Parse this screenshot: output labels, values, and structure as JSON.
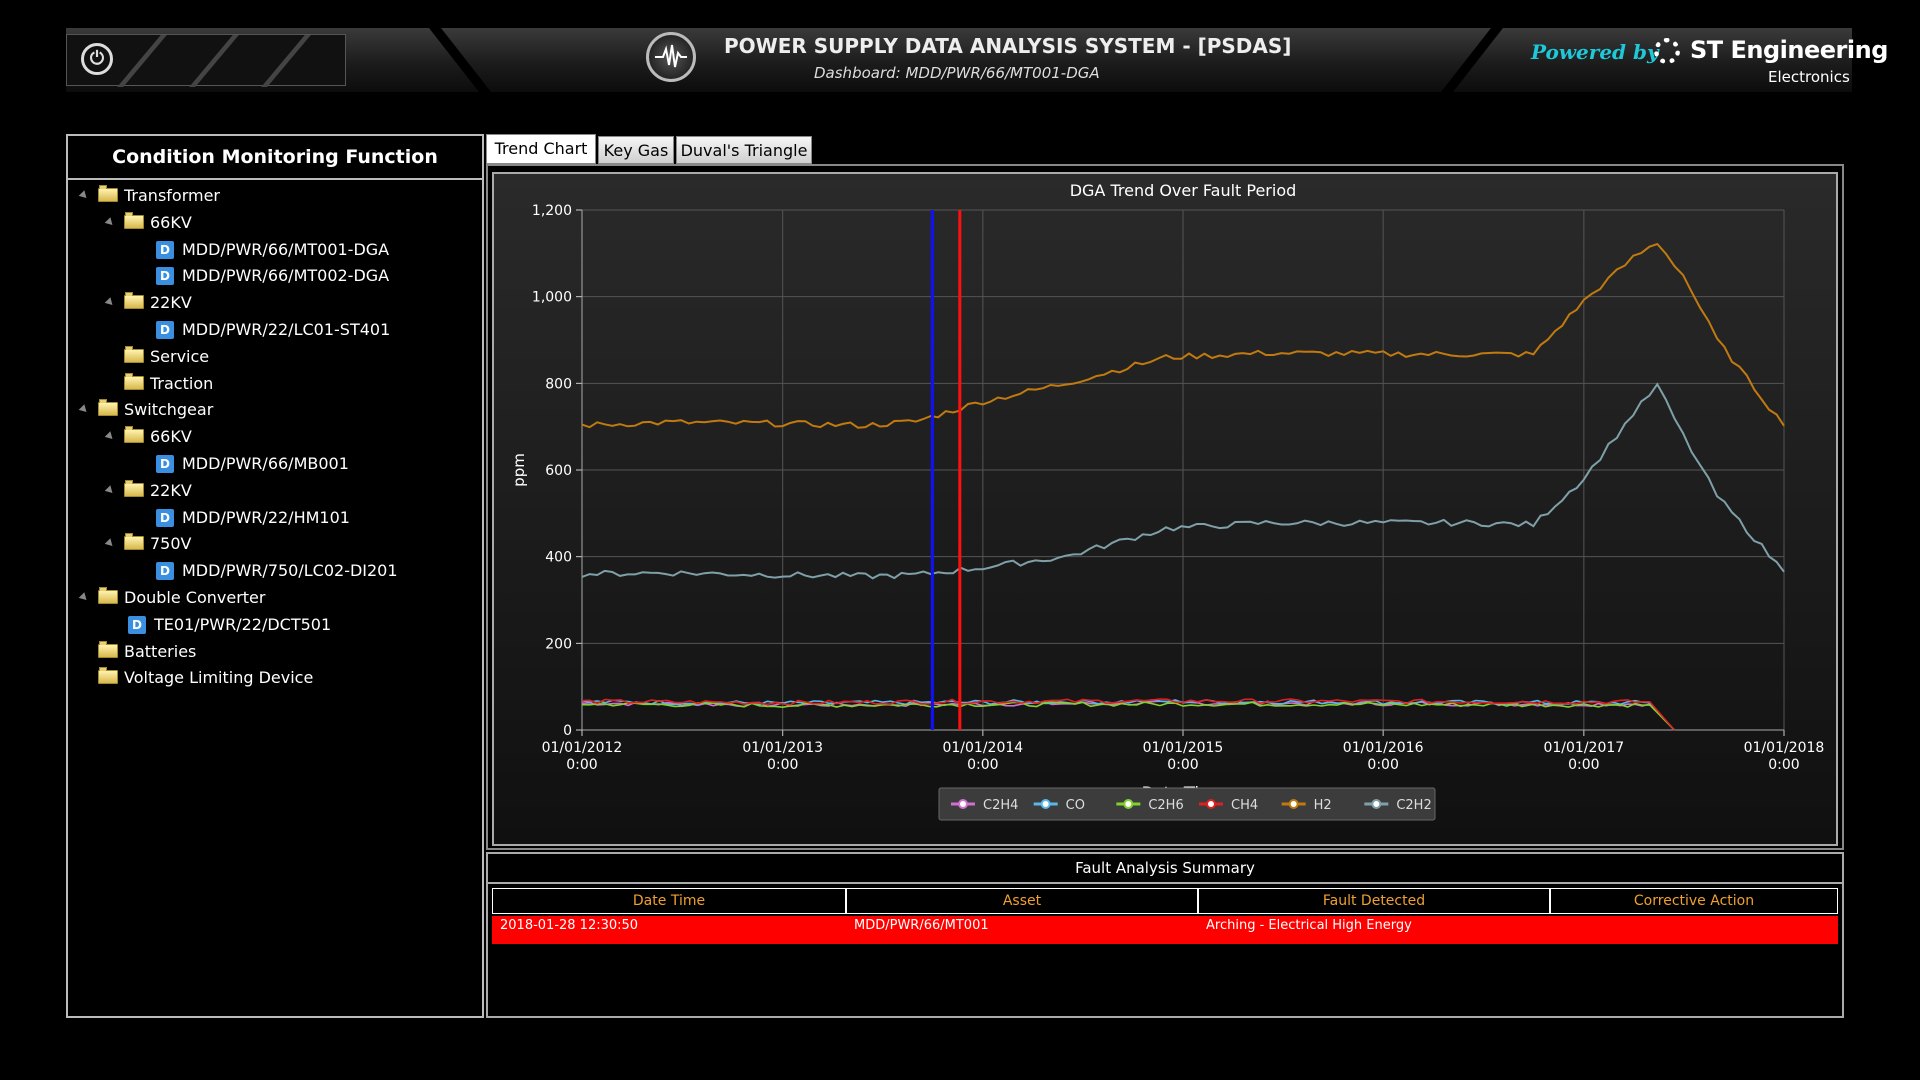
{
  "header": {
    "title": "POWER SUPPLY DATA ANALYSIS SYSTEM - [PSDAS]",
    "subtitle": "Dashboard: MDD/PWR/66/MT001-DGA",
    "powered_by": "Powered by",
    "brand": "ST Engineering",
    "brand_sub": "Electronics",
    "icons": [
      "power-icon",
      "waveform-logo-icon",
      "st-engineering-logo-icon"
    ]
  },
  "left_panel": {
    "title": "Condition Monitoring Function",
    "tree": [
      {
        "label": "Transformer",
        "type": "folder",
        "level": 0,
        "expanded": true
      },
      {
        "label": "66KV",
        "type": "folder",
        "level": 1,
        "expanded": true
      },
      {
        "label": "MDD/PWR/66/MT001-DGA",
        "type": "doc",
        "level": 2
      },
      {
        "label": "MDD/PWR/66/MT002-DGA",
        "type": "doc",
        "level": 2
      },
      {
        "label": "22KV",
        "type": "folder",
        "level": 1,
        "expanded": true
      },
      {
        "label": "MDD/PWR/22/LC01-ST401",
        "type": "doc",
        "level": 2
      },
      {
        "label": "Service",
        "type": "folder",
        "level": 1
      },
      {
        "label": "Traction",
        "type": "folder",
        "level": 1
      },
      {
        "label": "Switchgear",
        "type": "folder",
        "level": 0,
        "expanded": true
      },
      {
        "label": "66KV",
        "type": "folder",
        "level": 1,
        "expanded": true
      },
      {
        "label": "MDD/PWR/66/MB001",
        "type": "doc",
        "level": 2
      },
      {
        "label": "22KV",
        "type": "folder",
        "level": 1,
        "expanded": true
      },
      {
        "label": "MDD/PWR/22/HM101",
        "type": "doc",
        "level": 2
      },
      {
        "label": "750V",
        "type": "folder",
        "level": 1,
        "expanded": true
      },
      {
        "label": "MDD/PWR/750/LC02-DI201",
        "type": "doc",
        "level": 2
      },
      {
        "label": "Double Converter",
        "type": "folder",
        "level": 0,
        "expanded": true
      },
      {
        "label": "TE01/PWR/22/DCT501",
        "type": "doc",
        "level": 1
      },
      {
        "label": "Batteries",
        "type": "folder",
        "level": 0
      },
      {
        "label": "Voltage Limiting Device",
        "type": "folder",
        "level": 0
      }
    ],
    "doc_badge": "D"
  },
  "tabs": [
    {
      "label": "Trend Chart",
      "active": true
    },
    {
      "label": "Key Gas",
      "active": false
    },
    {
      "label": "Duval's Triangle",
      "active": false
    }
  ],
  "chart_data": {
    "type": "line",
    "title": "DGA Trend Over Fault Period",
    "xlabel": "Date/Time",
    "ylabel": "ppm",
    "ylim": [
      0,
      1200
    ],
    "yticks": [
      0,
      200,
      400,
      600,
      800,
      1000,
      1200
    ],
    "ytick_labels": [
      "0",
      "200",
      "400",
      "600",
      "800",
      "1,000",
      "1,200"
    ],
    "xlim": [
      "2012-01-01",
      "2018-01-01"
    ],
    "xticks": [
      "2012-01-01",
      "2013-01-01",
      "2014-01-01",
      "2015-01-01",
      "2016-01-01",
      "2017-01-01",
      "2018-01-01"
    ],
    "xtick_labels": [
      [
        "01/01/2012",
        "0:00"
      ],
      [
        "01/01/2013",
        "0:00"
      ],
      [
        "01/01/2014",
        "0:00"
      ],
      [
        "01/01/2015",
        "0:00"
      ],
      [
        "01/01/2016",
        "0:00"
      ],
      [
        "01/01/2017",
        "0:00"
      ],
      [
        "01/01/2018",
        "0:00"
      ]
    ],
    "grid": true,
    "legend_position": "bottom",
    "markers": [
      {
        "date": "2013-10-01",
        "color": "#1010ff"
      },
      {
        "date": "2013-11-20",
        "color": "#ff1010"
      }
    ],
    "series": [
      {
        "name": "C2H4",
        "color": "#d070d0",
        "dates": [
          "2012-01-01",
          "2013-01-01",
          "2014-01-01",
          "2015-01-01",
          "2016-01-01",
          "2017-01-01",
          "2017-05-01",
          "2017-06-15"
        ],
        "values": [
          62,
          58,
          60,
          62,
          61,
          60,
          60,
          0
        ]
      },
      {
        "name": "CO",
        "color": "#5ab8e8",
        "dates": [
          "2012-01-01",
          "2013-01-01",
          "2014-01-01",
          "2015-01-01",
          "2016-01-01",
          "2017-01-01",
          "2017-05-01",
          "2017-06-15"
        ],
        "values": [
          65,
          62,
          64,
          66,
          64,
          63,
          63,
          0
        ]
      },
      {
        "name": "C2H6",
        "color": "#80d030",
        "dates": [
          "2012-01-01",
          "2013-01-01",
          "2014-01-01",
          "2015-01-01",
          "2016-01-01",
          "2017-01-01",
          "2017-05-01",
          "2017-06-15"
        ],
        "values": [
          60,
          57,
          59,
          60,
          59,
          58,
          58,
          0
        ]
      },
      {
        "name": "CH4",
        "color": "#e02020",
        "dates": [
          "2012-01-01",
          "2013-01-01",
          "2014-01-01",
          "2015-01-01",
          "2016-01-01",
          "2017-01-01",
          "2017-05-01",
          "2017-06-15"
        ],
        "values": [
          66,
          63,
          66,
          67,
          66,
          65,
          65,
          0
        ]
      },
      {
        "name": "H2",
        "color": "#c07a10",
        "dates": [
          "2012-01-01",
          "2012-06-01",
          "2013-01-01",
          "2013-06-01",
          "2013-09-01",
          "2014-01-01",
          "2014-06-01",
          "2014-12-01",
          "2015-06-01",
          "2016-01-01",
          "2016-06-01",
          "2016-10-01",
          "2017-01-01",
          "2017-04-01",
          "2017-05-15",
          "2017-07-01",
          "2017-09-01",
          "2018-01-01"
        ],
        "values": [
          703,
          710,
          707,
          703,
          712,
          758,
          800,
          860,
          870,
          868,
          867,
          867,
          990,
          1090,
          1125,
          1050,
          900,
          702
        ]
      },
      {
        "name": "C2H2",
        "color": "#7fa0a8",
        "dates": [
          "2012-01-01",
          "2012-06-01",
          "2013-01-01",
          "2013-06-01",
          "2013-09-01",
          "2014-01-01",
          "2014-06-01",
          "2014-12-01",
          "2015-06-01",
          "2016-01-01",
          "2016-06-01",
          "2016-10-01",
          "2017-01-01",
          "2017-04-01",
          "2017-05-15",
          "2017-07-01",
          "2017-09-01",
          "2018-01-01"
        ],
        "values": [
          360,
          363,
          358,
          355,
          358,
          375,
          400,
          465,
          478,
          478,
          478,
          474,
          580,
          730,
          795,
          680,
          540,
          365
        ]
      }
    ]
  },
  "fault_summary": {
    "title": "Fault Analysis Summary",
    "columns": [
      "Date Time",
      "Asset",
      "Fault Detected",
      "Corrective Action"
    ],
    "header_color": "#f0a030",
    "highlight_color": "#ff0000",
    "rows": [
      [
        "2018-01-28 12:30:50",
        "MDD/PWR/66/MT001",
        "Arching - Electrical High Energy",
        ""
      ]
    ]
  }
}
